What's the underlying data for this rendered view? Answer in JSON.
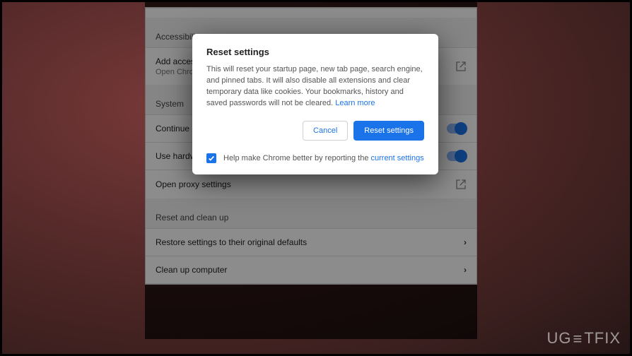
{
  "sections": {
    "accessibility": {
      "title": "Accessibility",
      "row_title": "Add access",
      "row_sub": "Open Chro"
    },
    "system": {
      "title": "System",
      "row1": "Continue r",
      "row2": "Use hardware acceleration when available",
      "row3": "Open proxy settings"
    },
    "reset": {
      "title": "Reset and clean up",
      "row1": "Restore settings to their original defaults",
      "row2": "Clean up computer"
    }
  },
  "dialog": {
    "title": "Reset settings",
    "body": "This will reset your startup page, new tab page, search engine, and pinned tabs. It will also disable all extensions and clear temporary data like cookies. Your bookmarks, history and saved passwords will not be cleared. ",
    "learn_more": "Learn more",
    "cancel": "Cancel",
    "confirm": "Reset settings",
    "help_pre": "Help make Chrome better by reporting the ",
    "help_link": "current settings"
  },
  "watermark": {
    "pre": "UG",
    "mid": "≡",
    "post": "TFIX"
  }
}
